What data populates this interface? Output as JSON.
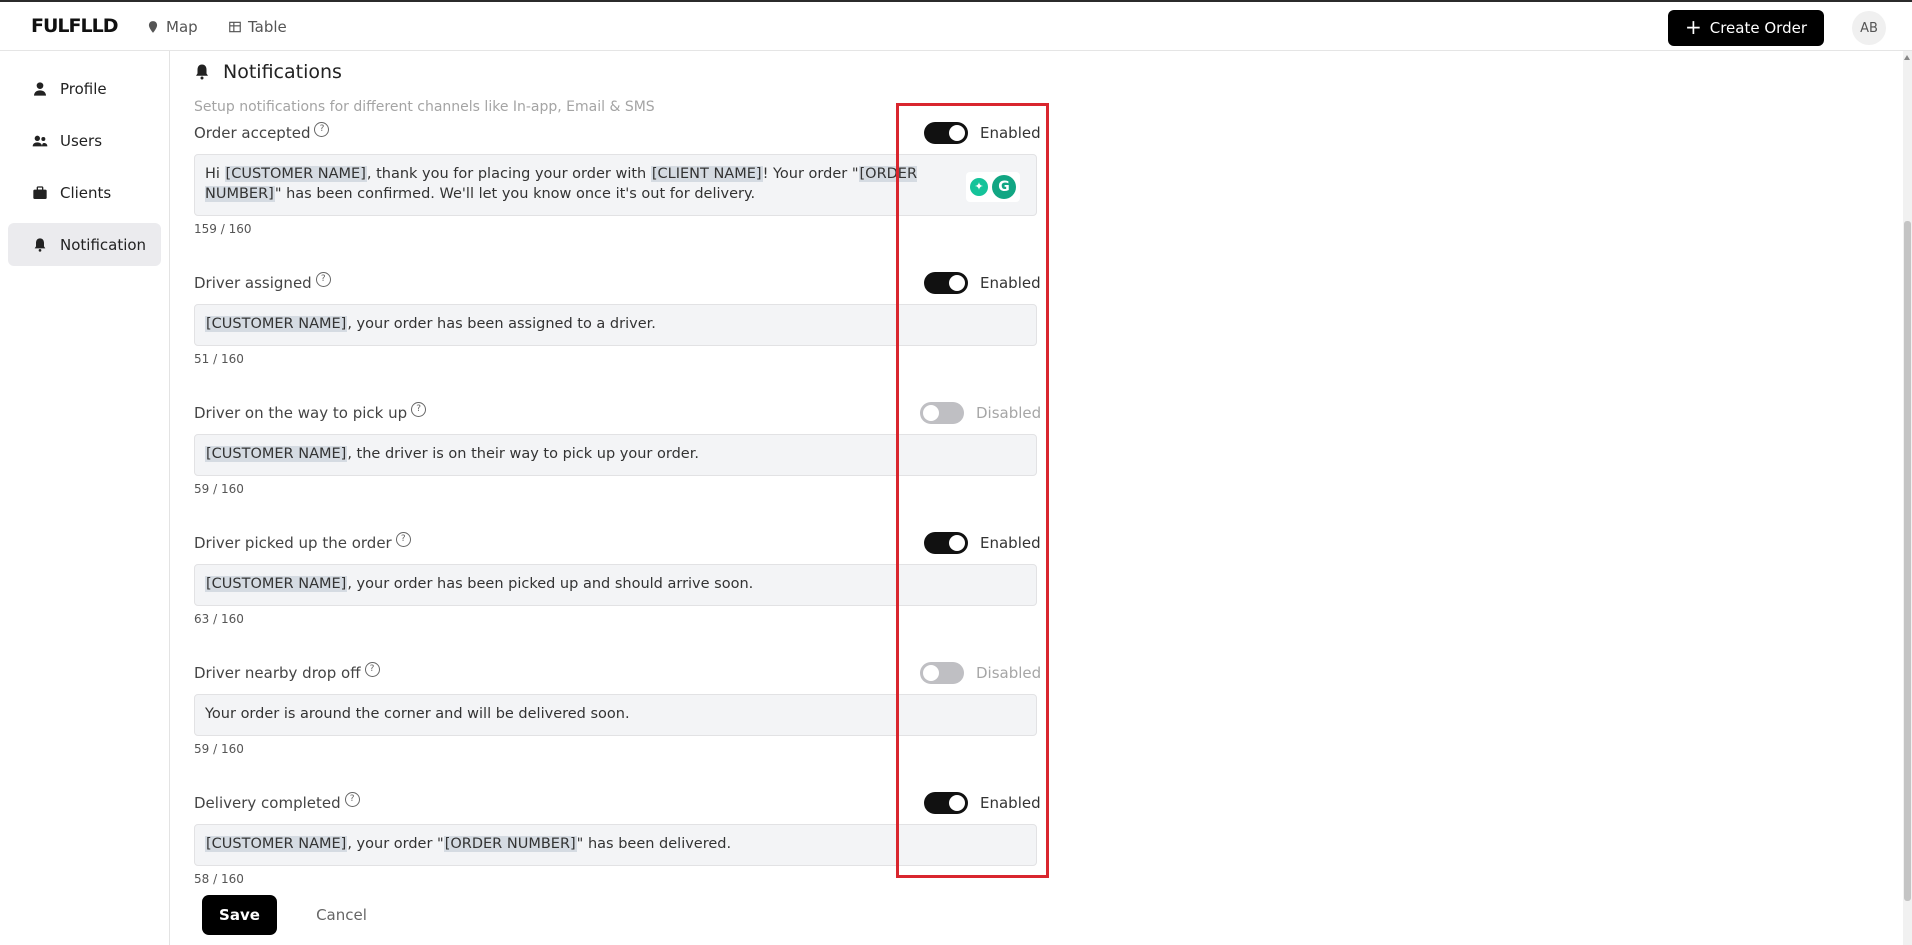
{
  "topbar": {
    "logo": "FULFLLD",
    "nav": [
      {
        "label": "Map",
        "icon": "map-pin-icon"
      },
      {
        "label": "Table",
        "icon": "table-icon"
      }
    ],
    "create_button": "Create Order",
    "avatar": "AB"
  },
  "sidebar": {
    "items": [
      {
        "label": "Profile",
        "icon": "user-icon",
        "active": false
      },
      {
        "label": "Users",
        "icon": "users-icon",
        "active": false
      },
      {
        "label": "Clients",
        "icon": "briefcase-icon",
        "active": false
      },
      {
        "label": "Notification",
        "icon": "bell-icon",
        "active": true
      }
    ]
  },
  "main": {
    "title": "Notifications",
    "subtitle": "Setup notifications for different channels like In-app, Email & SMS",
    "notifications": [
      {
        "label": "Order accepted",
        "status": "Enabled",
        "enabled": true,
        "message_parts": [
          "Hi ",
          "[CUSTOMER NAME]",
          ", thank you for placing your order with ",
          "[CLIENT NAME]",
          "! Your order \"",
          "[ORDER NUMBER]",
          "\" has been confirmed. We'll let you know once it's out for delivery."
        ],
        "counter": "159 / 160"
      },
      {
        "label": "Driver assigned",
        "status": "Enabled",
        "enabled": true,
        "message_parts": [
          "[CUSTOMER NAME]",
          ", your order has been assigned to a driver."
        ],
        "counter": "51 / 160"
      },
      {
        "label": "Driver on the way to pick up",
        "status": "Disabled",
        "enabled": false,
        "message_parts": [
          "[CUSTOMER NAME]",
          ", the driver is on their way to pick up your order."
        ],
        "counter": "59 / 160"
      },
      {
        "label": "Driver picked up the order",
        "status": "Enabled",
        "enabled": true,
        "message_parts": [
          "[CUSTOMER NAME]",
          ", your order has been picked up and should arrive soon."
        ],
        "counter": "63 / 160"
      },
      {
        "label": "Driver nearby drop off",
        "status": "Disabled",
        "enabled": false,
        "message_parts": [
          "Your order is around the corner and will be delivered soon."
        ],
        "counter": "59 / 160"
      },
      {
        "label": "Delivery completed",
        "status": "Enabled",
        "enabled": true,
        "message_parts": [
          "[CUSTOMER NAME]",
          ", your order \"",
          "[ORDER NUMBER]",
          "\" has been delivered."
        ],
        "counter": "58 / 160"
      }
    ],
    "save_label": "Save",
    "cancel_label": "Cancel"
  },
  "colors": {
    "accent": "#000000",
    "toggle_off": "#bfbfc3",
    "highlight": "#d9262e",
    "tag_bg": "#d5dbe2"
  }
}
